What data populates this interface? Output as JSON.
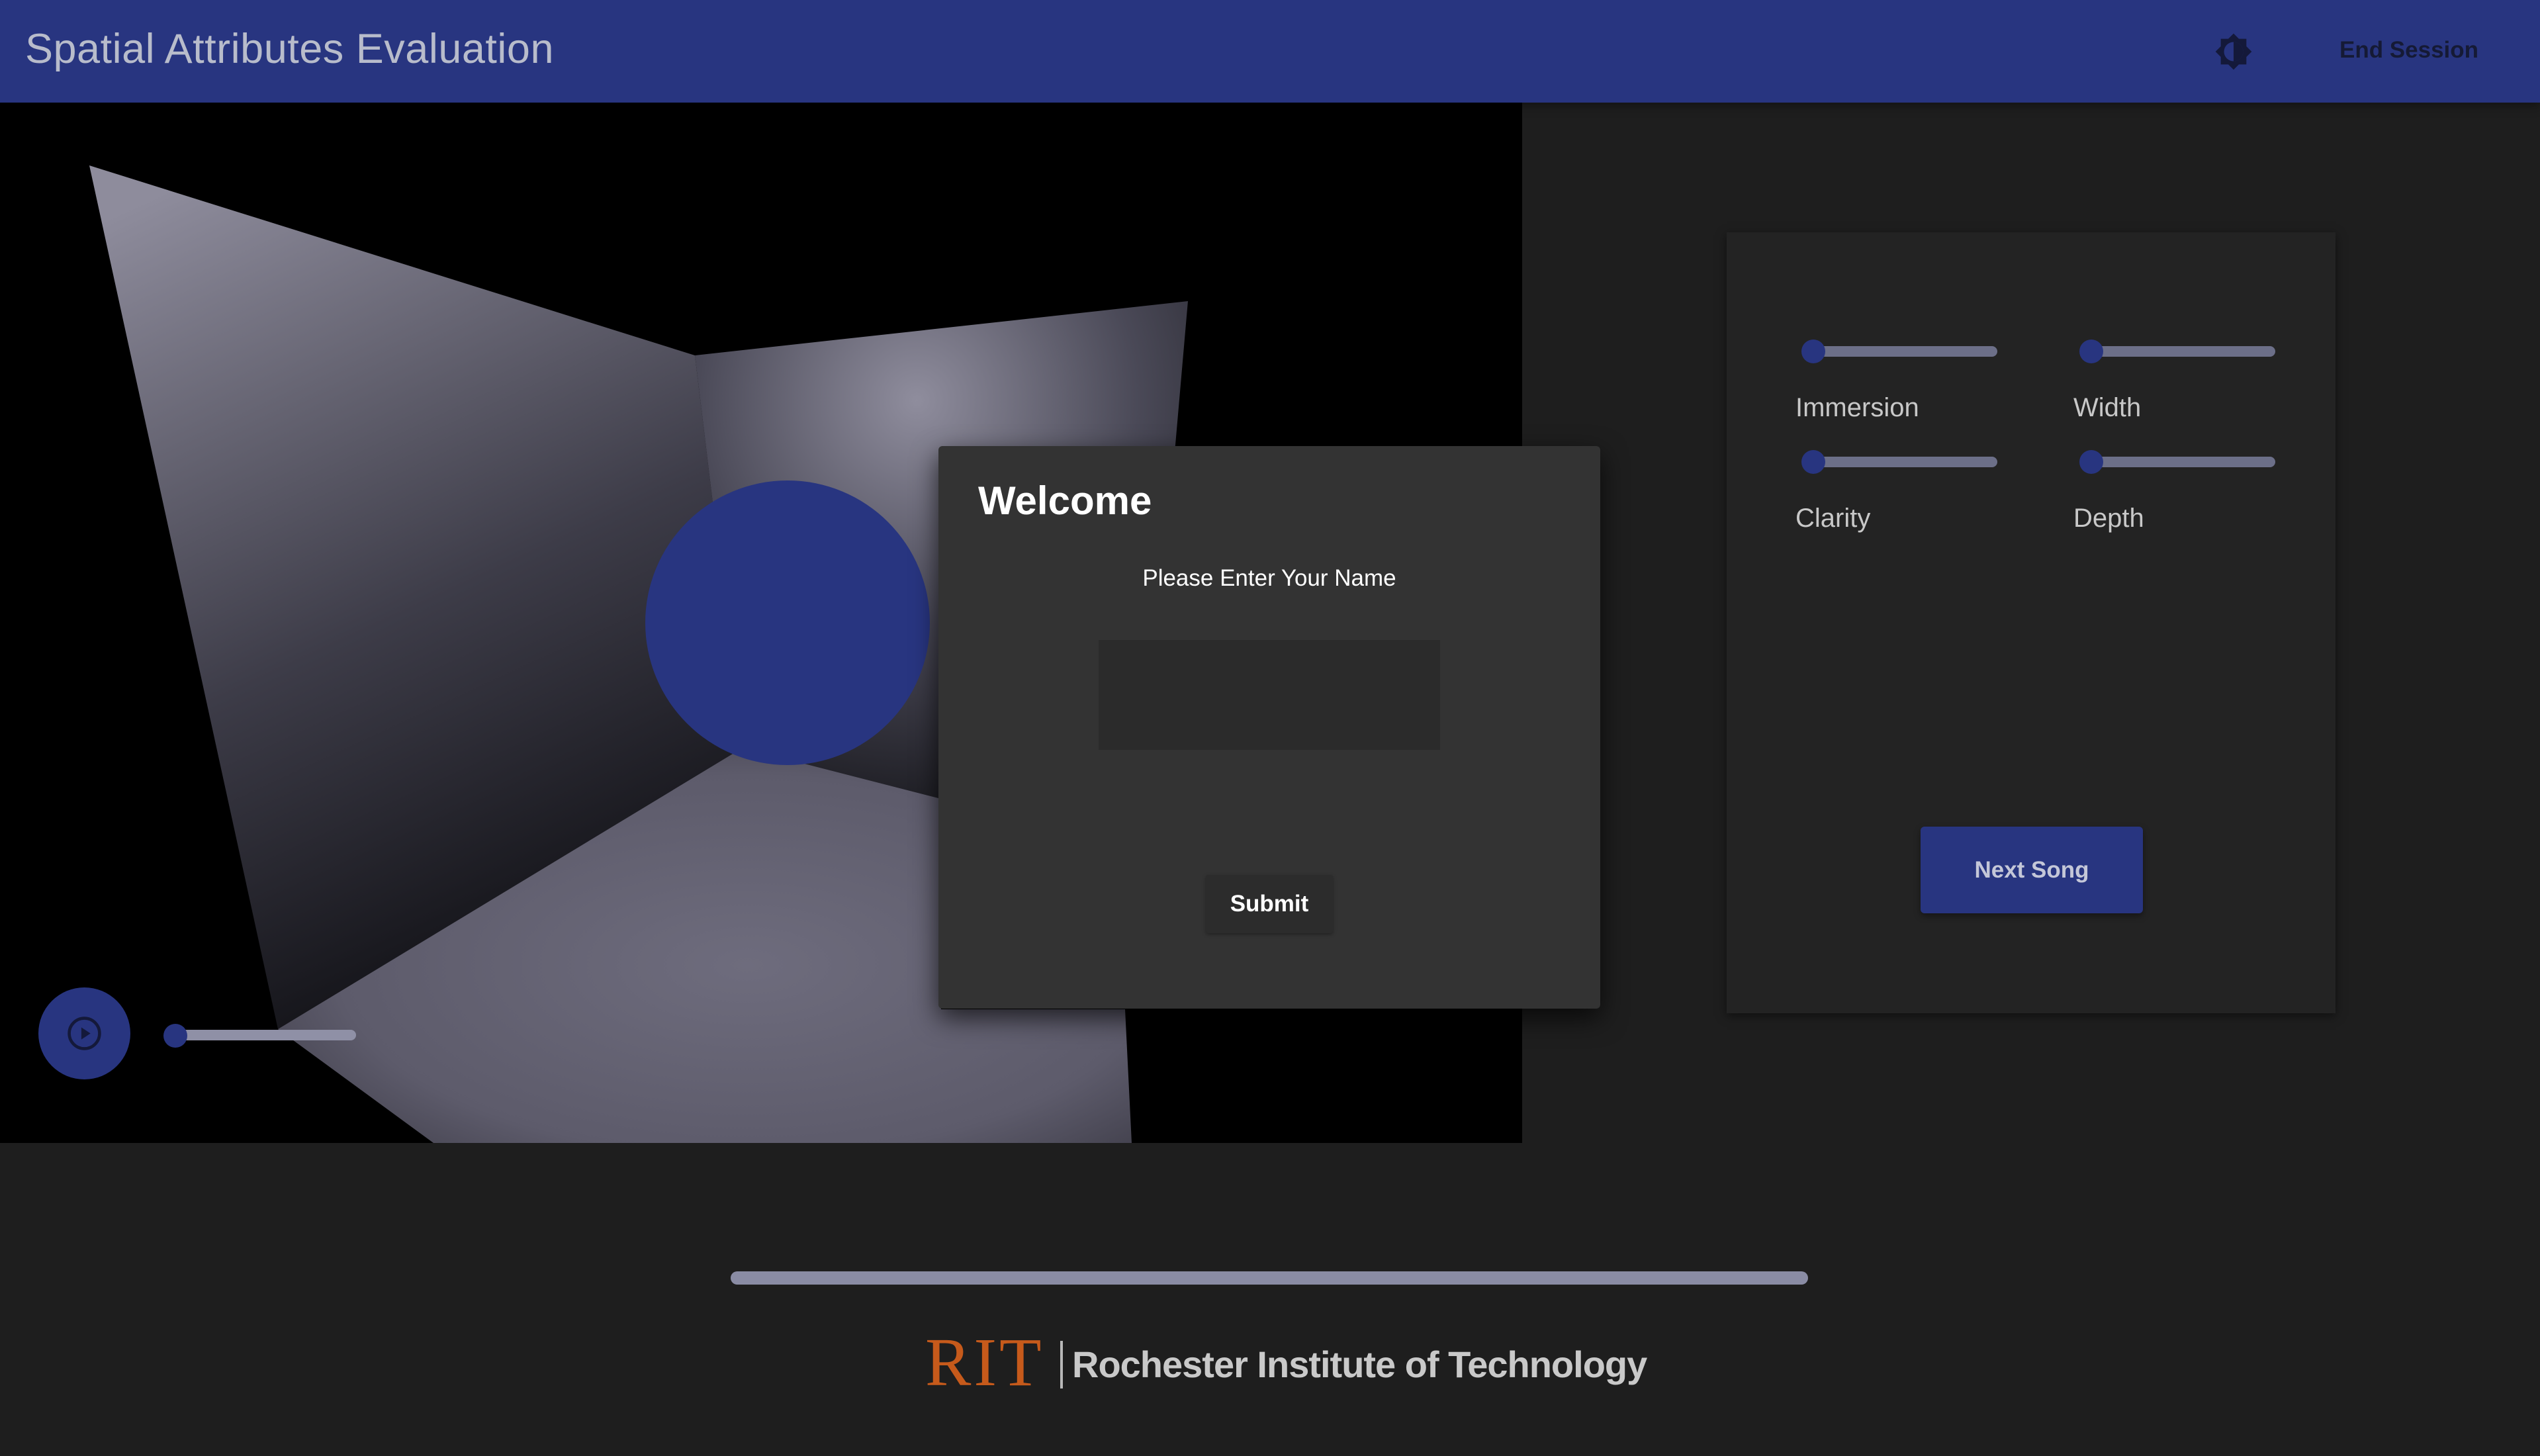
{
  "header": {
    "title": "Spatial Attributes Evaluation",
    "theme_toggle_icon": "brightness-icon",
    "end_session_label": "End Session"
  },
  "player": {
    "play_icon": "play-circle-icon",
    "progress": 0.0
  },
  "ratings": {
    "sliders": [
      {
        "label": "Immersion",
        "value": 0
      },
      {
        "label": "Width",
        "value": 0
      },
      {
        "label": "Clarity",
        "value": 0
      },
      {
        "label": "Depth",
        "value": 0
      }
    ],
    "next_song_label": "Next Song"
  },
  "dialog": {
    "title": "Welcome",
    "prompt": "Please Enter Your Name",
    "name_value": "",
    "submit_label": "Submit"
  },
  "song_progress": 0.0,
  "footer": {
    "logo_letters": "RIT",
    "institution": "Rochester Institute of Technology"
  },
  "colors": {
    "accent": "#283580",
    "background": "#1e1e1e",
    "brand_orange": "#c65a1b"
  }
}
